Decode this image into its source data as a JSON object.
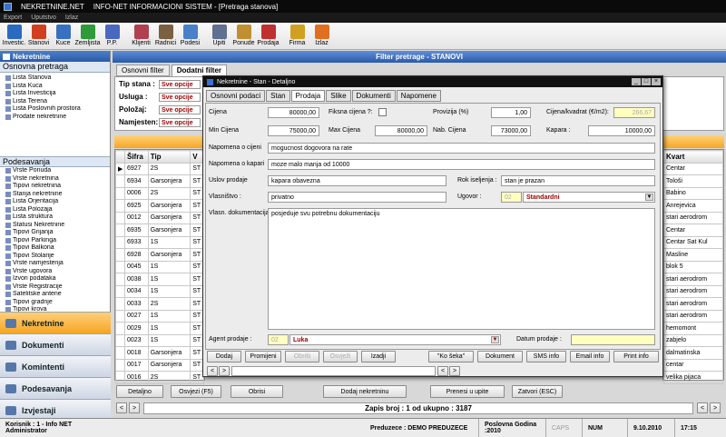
{
  "window": {
    "app": "NEKRETNINE.NET",
    "title": "INFO-NET INFORMACIONI SISTEM - [Pretraga stanova]"
  },
  "menu": [
    "Export",
    "Uputstvo",
    "Izlaz"
  ],
  "toolbar": [
    {
      "label": "Investic.",
      "color": "#2a6ac0"
    },
    {
      "label": "Stanovi",
      "color": "#d04020"
    },
    {
      "label": "Kuce",
      "color": "#3a70c0"
    },
    {
      "label": "Zemljista",
      "color": "#2f9a3a"
    },
    {
      "label": "P.P.",
      "color": "#4a68c0"
    },
    {
      "label": "Klijenti",
      "color": "#b04050"
    },
    {
      "label": "Radnici",
      "color": "#7a6040"
    },
    {
      "label": "Podesi",
      "color": "#4a80c8"
    },
    {
      "label": "Upiti",
      "color": "#607090"
    },
    {
      "label": "Ponude",
      "color": "#c09030"
    },
    {
      "label": "Prodaja",
      "color": "#c03030"
    },
    {
      "label": "Firma",
      "color": "#d0a020"
    },
    {
      "label": "Izlaz",
      "color": "#e07020"
    }
  ],
  "left": {
    "header": "Nekretnine",
    "section1": "Osnovna pretraga",
    "tree1": [
      "Lista Stanova",
      "Lista Kuca",
      "Lista Investicija",
      "Lista Terena",
      "Lista Poslovnih prostora",
      "Prodate nekretnine"
    ],
    "section2": "Podesavanja",
    "tree2": [
      "Vrste Ponuda",
      "Vrste nekretnina",
      "Tipovi nekretnina",
      "Stanja nekretnine",
      "Lista Orjentacija",
      "Lista Polozaja",
      "Lista struktura",
      "Statusi Nekretnine",
      "Tipovi Grijanja",
      "Tipovi Parkinga",
      "Tipovi Balkona",
      "Tipovi Stolarije",
      "Vrste namjestenja",
      "Vrste ugovora",
      "Izvori podataka",
      "Vrste Registracije",
      "Satelitske antene",
      "Tipovi gradnje",
      "Tipovi krova"
    ],
    "nav": [
      "Nekretnine",
      "Dokumenti",
      "Komintenti",
      "Podesavanja",
      "Izvjestaji"
    ]
  },
  "filter": {
    "header": "Filter pretrage - STANOVI",
    "tabs": [
      "Osnovni filter",
      "Dodatni filter"
    ],
    "fields": [
      {
        "label": "Tip stana :",
        "value": "Sve opcije"
      },
      {
        "label": "Usluga :",
        "value": "Sve opcije"
      },
      {
        "label": "Položaj:",
        "value": "Sve opcije"
      },
      {
        "label": "Namjesten:",
        "value": "Sve opcije"
      }
    ]
  },
  "grid": {
    "headers": [
      "Šifra",
      "Tip",
      "V"
    ],
    "right_header": "Kvart",
    "rows": [
      {
        "sifra": "6927",
        "tip": "2S",
        "v": "ST",
        "kvart": "Centar"
      },
      {
        "sifra": "6934",
        "tip": "Garsonjera",
        "v": "ST",
        "kvart": "Tološi"
      },
      {
        "sifra": "0006",
        "tip": "2S",
        "v": "ST",
        "kvart": "Babino"
      },
      {
        "sifra": "6925",
        "tip": "Garsonjera",
        "v": "ST",
        "kvart": "Anrejevica"
      },
      {
        "sifra": "0012",
        "tip": "Garsonjera",
        "v": "ST",
        "kvart": "stari aerodrom"
      },
      {
        "sifra": "6935",
        "tip": "Garsonjera",
        "v": "ST",
        "kvart": "Centar"
      },
      {
        "sifra": "6933",
        "tip": "1S",
        "v": "ST",
        "kvart": "Centar Sat Kul"
      },
      {
        "sifra": "6928",
        "tip": "Garsonjera",
        "v": "ST",
        "kvart": "Masline"
      },
      {
        "sifra": "0045",
        "tip": "1S",
        "v": "ST",
        "kvart": "blok 5"
      },
      {
        "sifra": "0038",
        "tip": "1S",
        "v": "ST",
        "kvart": "stari aerodrom"
      },
      {
        "sifra": "0034",
        "tip": "1S",
        "v": "ST",
        "kvart": "stari aerodrom"
      },
      {
        "sifra": "0033",
        "tip": "2S",
        "v": "ST",
        "kvart": "stari aerodrom"
      },
      {
        "sifra": "0027",
        "tip": "1S",
        "v": "ST",
        "kvart": "stari aerodrom"
      },
      {
        "sifra": "0029",
        "tip": "1S",
        "v": "ST",
        "kvart": "hemomont"
      },
      {
        "sifra": "0023",
        "tip": "1S",
        "v": "ST",
        "kvart": "zabjelo"
      },
      {
        "sifra": "0018",
        "tip": "Garsonjera",
        "v": "ST",
        "kvart": "dalmatinska"
      },
      {
        "sifra": "0017",
        "tip": "Garsonjera",
        "v": "ST",
        "kvart": "centar"
      },
      {
        "sifra": "0016",
        "tip": "2S",
        "v": "ST",
        "kvart": "velika pijaca"
      }
    ]
  },
  "bottom": {
    "buttons": [
      "Detaljno",
      "Osvjezi (F5)",
      "Obrisi",
      "Dodaj nekretninu",
      "Prenesi u upite",
      "Zatvori (ESC)"
    ],
    "record": "Zapis broj : 1 od ukupno : 3187"
  },
  "dialog": {
    "title": "Nekretnine - Stan - Detaljno",
    "tabs": [
      "Osnovni podaci",
      "Stan",
      "Prodaja",
      "Slike",
      "Dokumenti",
      "Napomene"
    ],
    "cijena_label": "Cijena",
    "cijena": "80000,00",
    "fiksna_label": "Fiksna cijena ?:",
    "provizija_label": "Provizija (%)",
    "provizija": "1,00",
    "cijena_kv_label": "Cijena/kvadrat (€/m2):",
    "cijena_kv": "266,67",
    "min_label": "Min Cijena",
    "min": "75000,00",
    "max_label": "Max Cijena",
    "max": "80000,00",
    "nab_label": "Nab. Cijena",
    "nab": "73000,00",
    "kapara_label": "Kapara :",
    "kapara": "10000,00",
    "nap_cijeni_label": "Napomena o cijeni",
    "nap_cijeni": "mogucnost dogovora na rate",
    "nap_kapari_label": "Napomena o kapari",
    "nap_kapari": "moze malo manja od 10000",
    "uslov_label": "Uslov prodaje",
    "uslov": "kapara obavezna",
    "rok_label": "Rok iseljenja :",
    "rok": "stan je prazan",
    "vlasnistvo_label": "Vlasništvo :",
    "vlasnistvo": "privatno",
    "ugovor_label": "Ugovor :",
    "ugovor_code": "02",
    "ugovor": "Standardni",
    "dok_label": "Vlasn. dokumentacija :",
    "dok": "posjeduje svu potrebnu dokumentaciju",
    "agent_label": "Agent prodaje :",
    "agent_code": "02",
    "agent": "Luka",
    "datum_label": "Datum prodaje :",
    "buttons": [
      "Dodaj",
      "Promijeni",
      "Obriši",
      "Osvježi",
      "Izadji",
      "\"Ko šeka\"",
      "Dokument",
      "SMS info",
      "Email info",
      "Print info"
    ]
  },
  "status": {
    "user": "Korisnik : 1 - Info NET  Administrator",
    "company": "Preduzece : DEMO PREDUZECE",
    "year": "Poslovna Godina :2010",
    "caps": "CAPS",
    "num": "NUM",
    "date": "9.10.2010",
    "time": "17:15"
  }
}
